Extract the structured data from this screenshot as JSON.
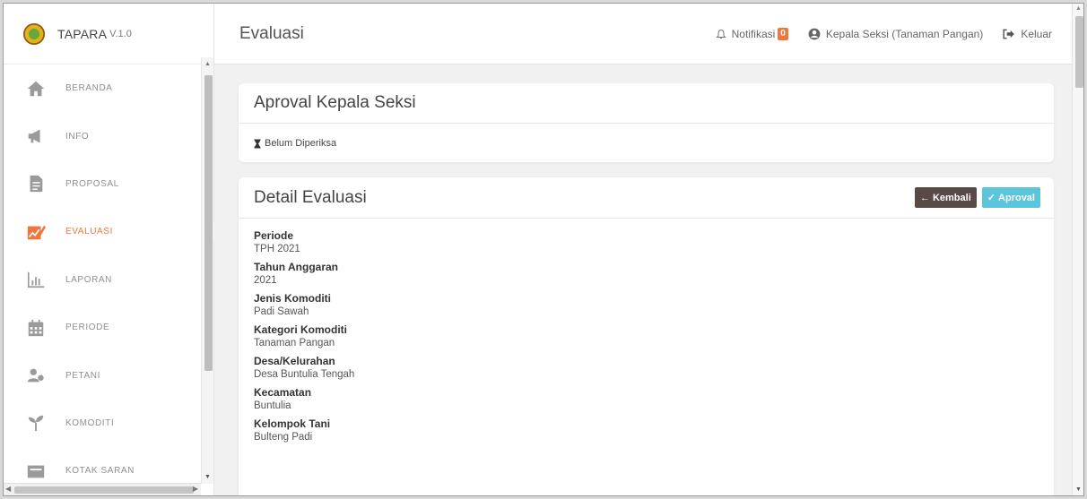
{
  "app": {
    "name": "TAPARA",
    "version": "V.1.0"
  },
  "sidebar": {
    "items": [
      {
        "label": "BERANDA",
        "icon": "home-icon",
        "active": false
      },
      {
        "label": "INFO",
        "icon": "megaphone-icon",
        "active": false
      },
      {
        "label": "PROPOSAL",
        "icon": "document-icon",
        "active": false
      },
      {
        "label": "EVALUASI",
        "icon": "edit-chart-icon",
        "active": true
      },
      {
        "label": "LAPORAN",
        "icon": "bar-chart-icon",
        "active": false
      },
      {
        "label": "PERIODE",
        "icon": "calendar-icon",
        "active": false
      },
      {
        "label": "PETANI",
        "icon": "users-icon",
        "active": false
      },
      {
        "label": "KOMODITI",
        "icon": "sprout-icon",
        "active": false
      },
      {
        "label": "KOTAK SARAN",
        "icon": "inbox-icon",
        "active": false
      }
    ]
  },
  "header": {
    "title": "Evaluasi",
    "notification_label": "Notifikasi",
    "notification_count": "0",
    "user_label": "Kepala Seksi (Tanaman Pangan)",
    "logout_label": "Keluar"
  },
  "approval_card": {
    "title": "Aproval Kepala Seksi",
    "status": "Belum Diperiksa"
  },
  "detail_card": {
    "title": "Detail Evaluasi",
    "back_label": "Kembali",
    "approve_label": "Aproval",
    "fields": [
      {
        "label": "Periode",
        "value": "TPH 2021"
      },
      {
        "label": "Tahun Anggaran",
        "value": "2021"
      },
      {
        "label": "Jenis Komoditi",
        "value": "Padi Sawah"
      },
      {
        "label": "Kategori Komoditi",
        "value": "Tanaman Pangan"
      },
      {
        "label": "Desa/Kelurahan",
        "value": "Desa Buntulia Tengah"
      },
      {
        "label": "Kecamatan",
        "value": "Buntulia"
      },
      {
        "label": "Kelompok Tani",
        "value": "Bulteng Padi"
      }
    ]
  },
  "colors": {
    "accent": "#f0763d",
    "teal": "#5bc5dc",
    "dark_button": "#5a4a46"
  }
}
